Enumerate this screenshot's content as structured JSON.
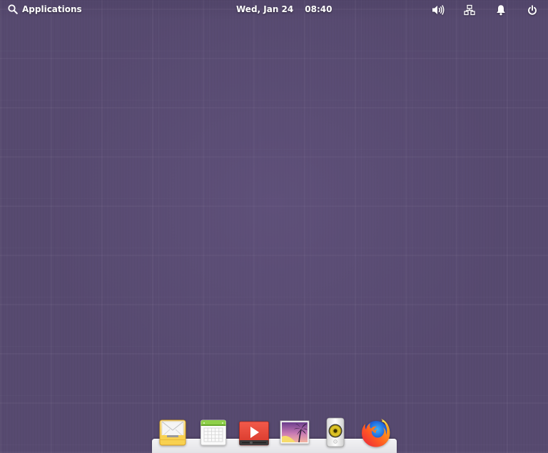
{
  "panel": {
    "applications_label": "Applications",
    "date": "Wed, Jan 24",
    "time": "08:40",
    "indicators": [
      {
        "name": "volume",
        "icon": "volume-icon"
      },
      {
        "name": "network",
        "icon": "network-wired-icon"
      },
      {
        "name": "notifications",
        "icon": "bell-icon"
      },
      {
        "name": "session",
        "icon": "power-icon"
      }
    ]
  },
  "dock": {
    "items": [
      {
        "app": "Mail",
        "icon": "mail-icon"
      },
      {
        "app": "Calendar",
        "icon": "calendar-icon"
      },
      {
        "app": "Videos",
        "icon": "video-player-icon"
      },
      {
        "app": "Photos",
        "icon": "photos-icon"
      },
      {
        "app": "Music",
        "icon": "music-speaker-icon"
      },
      {
        "app": "Firefox",
        "icon": "firefox-icon"
      }
    ]
  },
  "colors": {
    "desktop_background": "#574a70",
    "panel_text": "#ffffff",
    "dock_plate": "#ececef"
  }
}
